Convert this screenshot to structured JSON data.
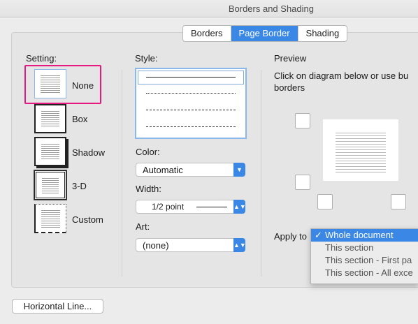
{
  "window": {
    "title": "Borders and Shading"
  },
  "tabs": [
    {
      "label": "Borders"
    },
    {
      "label": "Page Border"
    },
    {
      "label": "Shading"
    }
  ],
  "setting": {
    "heading": "Setting:",
    "options": [
      {
        "label": "None"
      },
      {
        "label": "Box"
      },
      {
        "label": "Shadow"
      },
      {
        "label": "3-D"
      },
      {
        "label": "Custom"
      }
    ]
  },
  "style": {
    "heading": "Style:"
  },
  "color": {
    "heading": "Color:",
    "value": "Automatic"
  },
  "width": {
    "heading": "Width:",
    "value": "1/2 point"
  },
  "art": {
    "heading": "Art:",
    "value": "(none)"
  },
  "preview": {
    "heading": "Preview",
    "instruction_line1": "Click on diagram below or use bu",
    "instruction_line2": "borders"
  },
  "apply_to": {
    "label": "Apply to",
    "options": [
      "Whole document",
      "This section",
      "This section - First pa",
      "This section - All exce"
    ],
    "selected_index": 0
  },
  "buttons": {
    "horizontal_line": "Horizontal Line..."
  }
}
